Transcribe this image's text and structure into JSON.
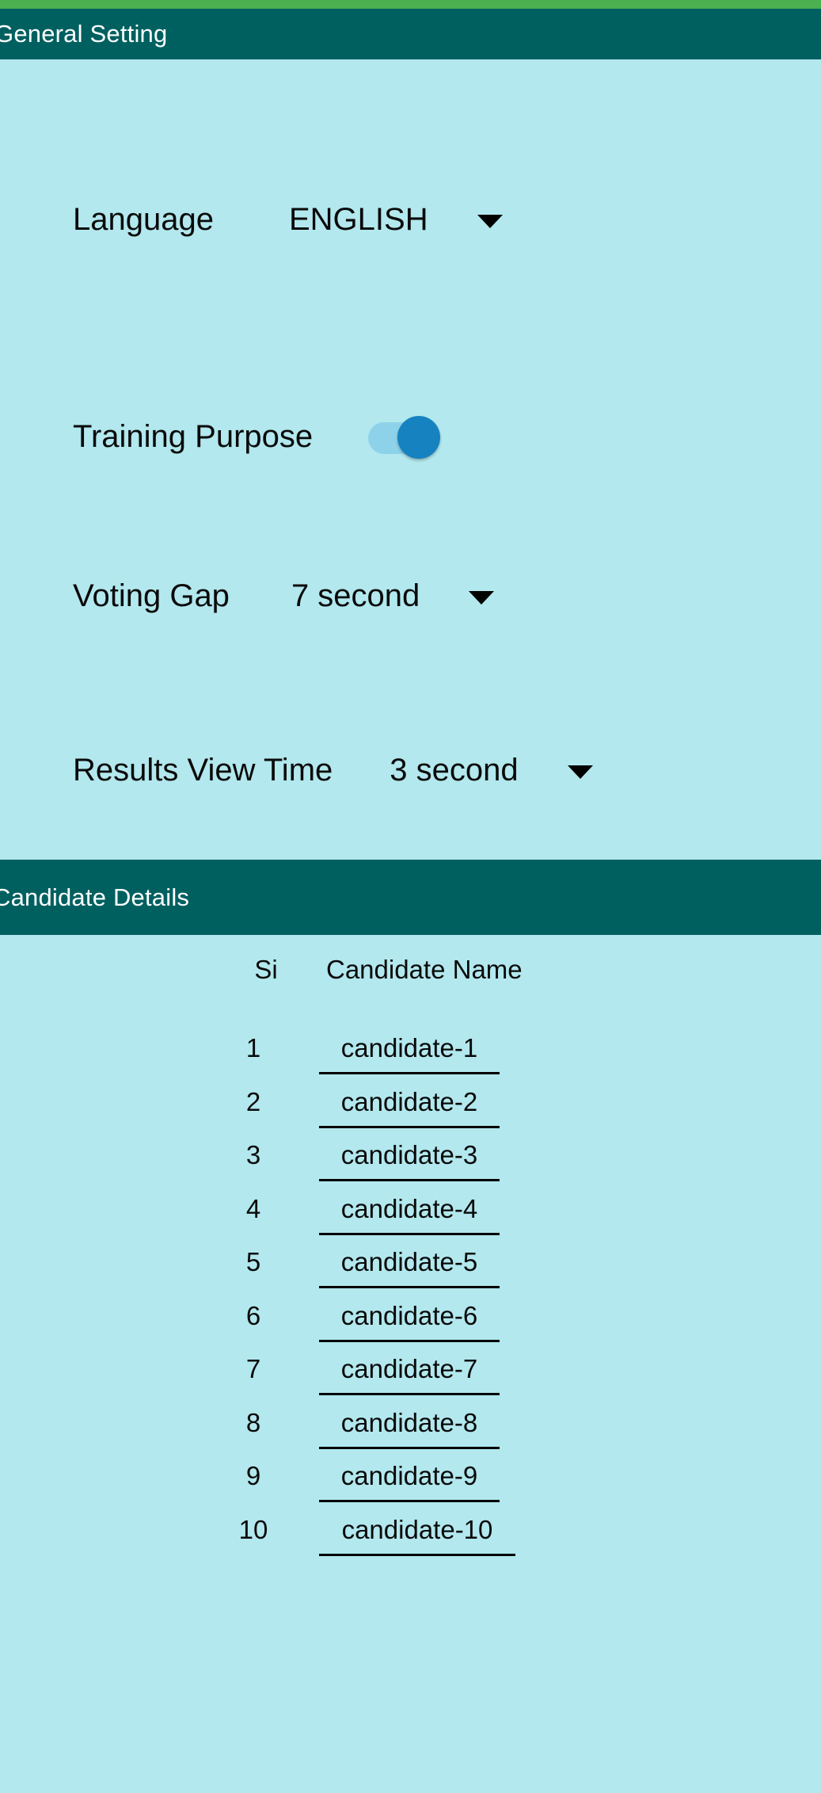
{
  "theme": {
    "accent_strip": "#4caf50",
    "section_bar": "#006060",
    "body_background": "#b2e8ee",
    "switch_track": "#8ed2ea",
    "switch_thumb": "#1682c0",
    "text": "#0a0a0a",
    "section_title_text": "#ffffff"
  },
  "general_setting": {
    "title": "General Setting",
    "rows": [
      {
        "label": "Language",
        "value": "ENGLISH",
        "control": "dropdown"
      },
      {
        "label": "Training Purpose",
        "value": "",
        "control": "switch",
        "checked": true
      },
      {
        "label": "Voting Gap",
        "value": "7 second",
        "control": "dropdown"
      },
      {
        "label": "Results View Time",
        "value": "3 second",
        "control": "dropdown"
      }
    ],
    "icons": {
      "dropdown": "caret-down-icon",
      "switch": "toggle-switch-icon"
    }
  },
  "candidate_details": {
    "title": "Candidate Details",
    "columns": [
      "Si",
      "Candidate Name"
    ],
    "rows": [
      {
        "si": "1",
        "name": "candidate-1"
      },
      {
        "si": "2",
        "name": "candidate-2"
      },
      {
        "si": "3",
        "name": "candidate-3"
      },
      {
        "si": "4",
        "name": "candidate-4"
      },
      {
        "si": "5",
        "name": "candidate-5"
      },
      {
        "si": "6",
        "name": "candidate-6"
      },
      {
        "si": "7",
        "name": "candidate-7"
      },
      {
        "si": "8",
        "name": "candidate-8"
      },
      {
        "si": "9",
        "name": "candidate-9"
      },
      {
        "si": "10",
        "name": "candidate-10"
      }
    ]
  }
}
